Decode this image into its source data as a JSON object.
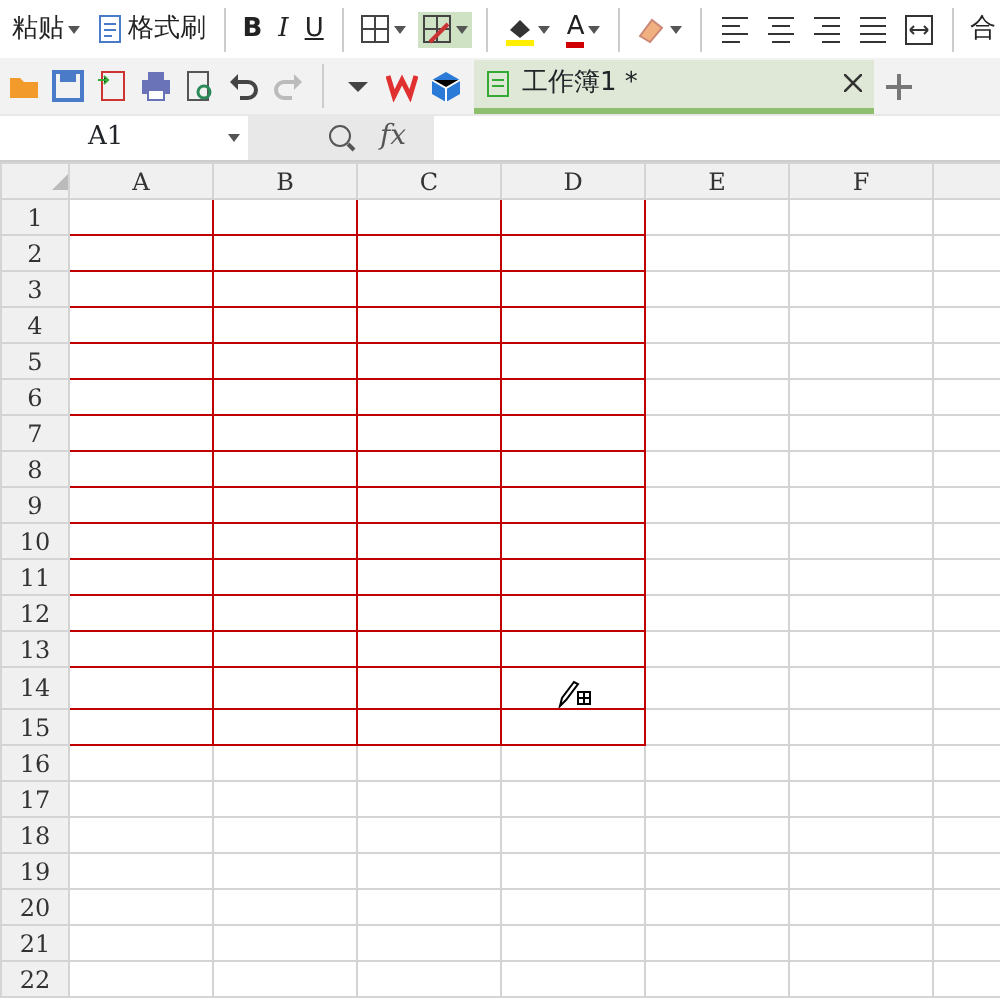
{
  "ribbon": [
    {
      "kind": "paste",
      "label": "粘贴"
    },
    {
      "kind": "painter",
      "label": "格式刷"
    },
    {
      "kind": "sep"
    },
    {
      "kind": "bold",
      "label": "B"
    },
    {
      "kind": "italic",
      "label": "I"
    },
    {
      "kind": "underline",
      "label": "U"
    },
    {
      "kind": "sep"
    },
    {
      "kind": "borders",
      "selected": false
    },
    {
      "kind": "drawborder",
      "selected": true
    },
    {
      "kind": "sep"
    },
    {
      "kind": "fill"
    },
    {
      "kind": "fontcolor",
      "label": "A"
    },
    {
      "kind": "sep"
    },
    {
      "kind": "eraser"
    },
    {
      "kind": "sep"
    },
    {
      "kind": "alignleft"
    },
    {
      "kind": "aligncenter"
    },
    {
      "kind": "alignright"
    },
    {
      "kind": "justify"
    },
    {
      "kind": "merge"
    },
    {
      "kind": "sep"
    },
    {
      "kind": "cut",
      "label": "合"
    }
  ],
  "quick_access": [
    {
      "kind": "open"
    },
    {
      "kind": "save"
    },
    {
      "kind": "export"
    },
    {
      "kind": "print"
    },
    {
      "kind": "preview"
    },
    {
      "kind": "undo"
    },
    {
      "kind": "redo"
    },
    {
      "kind": "sep"
    },
    {
      "kind": "more"
    },
    {
      "kind": "wps"
    },
    {
      "kind": "cube"
    }
  ],
  "document_tab": {
    "title": "工作簿1 *",
    "selected": true
  },
  "name_box": {
    "value": "A1"
  },
  "formula_bar": {
    "fx": "fx"
  },
  "columns": [
    {
      "label": "A",
      "bordered": true
    },
    {
      "label": "B",
      "bordered": true
    },
    {
      "label": "C",
      "bordered": true
    },
    {
      "label": "D",
      "bordered": true
    },
    {
      "label": "E",
      "bordered": false
    },
    {
      "label": "F",
      "bordered": false
    }
  ],
  "rows": [
    {
      "label": "1",
      "bordered": true
    },
    {
      "label": "2",
      "bordered": true
    },
    {
      "label": "3",
      "bordered": true
    },
    {
      "label": "4",
      "bordered": true
    },
    {
      "label": "5",
      "bordered": true
    },
    {
      "label": "6",
      "bordered": true
    },
    {
      "label": "7",
      "bordered": true
    },
    {
      "label": "8",
      "bordered": true
    },
    {
      "label": "9",
      "bordered": true
    },
    {
      "label": "10",
      "bordered": true
    },
    {
      "label": "11",
      "bordered": true
    },
    {
      "label": "12",
      "bordered": true
    },
    {
      "label": "13",
      "bordered": true
    },
    {
      "label": "14",
      "bordered": true
    },
    {
      "label": "15",
      "bordered": true
    },
    {
      "label": "16",
      "bordered": false
    },
    {
      "label": "17",
      "bordered": false
    },
    {
      "label": "18",
      "bordered": false
    },
    {
      "label": "19",
      "bordered": false
    },
    {
      "label": "20",
      "bordered": false
    },
    {
      "label": "21",
      "bordered": false
    },
    {
      "label": "22",
      "bordered": false
    }
  ]
}
